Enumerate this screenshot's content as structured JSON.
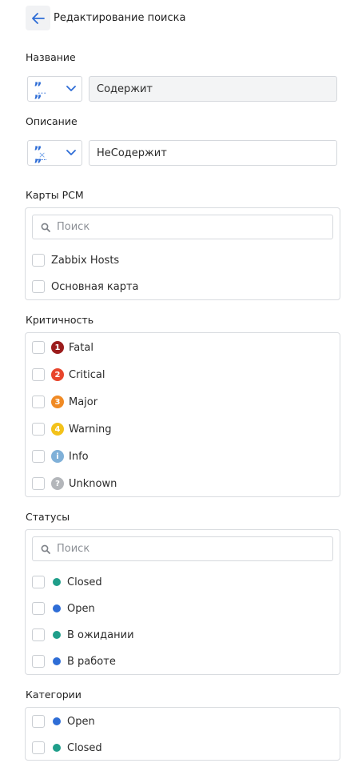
{
  "header": {
    "title": "Редактирование поиска"
  },
  "colors": {
    "accent": "#2e6dd6",
    "teal": "#1f9e8a",
    "blue": "#2e6dd6"
  },
  "name_field": {
    "label": "Название",
    "operator_icon": "contains-quote-icon",
    "value": "Содержит"
  },
  "description_field": {
    "label": "Описание",
    "operator_icon": "not-contains-quote-icon",
    "value": "НеСодержит"
  },
  "maps": {
    "label": "Карты РСМ",
    "search_placeholder": "Поиск",
    "items": [
      {
        "label": "Zabbix Hosts"
      },
      {
        "label": "Основная карта"
      }
    ]
  },
  "severity": {
    "label": "Критичность",
    "items": [
      {
        "badge": "1",
        "label": "Fatal",
        "color": "#9b1c1c"
      },
      {
        "badge": "2",
        "label": "Critical",
        "color": "#e8452c"
      },
      {
        "badge": "3",
        "label": "Major",
        "color": "#f08a24"
      },
      {
        "badge": "4",
        "label": "Warning",
        "color": "#f3c21a"
      },
      {
        "badge": "i",
        "label": "Info",
        "color": "#7fb0d8"
      },
      {
        "badge": "?",
        "label": "Unknown",
        "color": "#b3b6ba"
      }
    ]
  },
  "statuses": {
    "label": "Статусы",
    "search_placeholder": "Поиск",
    "items": [
      {
        "label": "Closed",
        "color": "#1f9e8a"
      },
      {
        "label": "Open",
        "color": "#2e6dd6"
      },
      {
        "label": "В ожидании",
        "color": "#1f9e8a"
      },
      {
        "label": "В работе",
        "color": "#2e6dd6"
      }
    ]
  },
  "categories": {
    "label": "Категории",
    "items": [
      {
        "label": "Open",
        "color": "#2e6dd6"
      },
      {
        "label": "Closed",
        "color": "#1f9e8a"
      }
    ]
  }
}
